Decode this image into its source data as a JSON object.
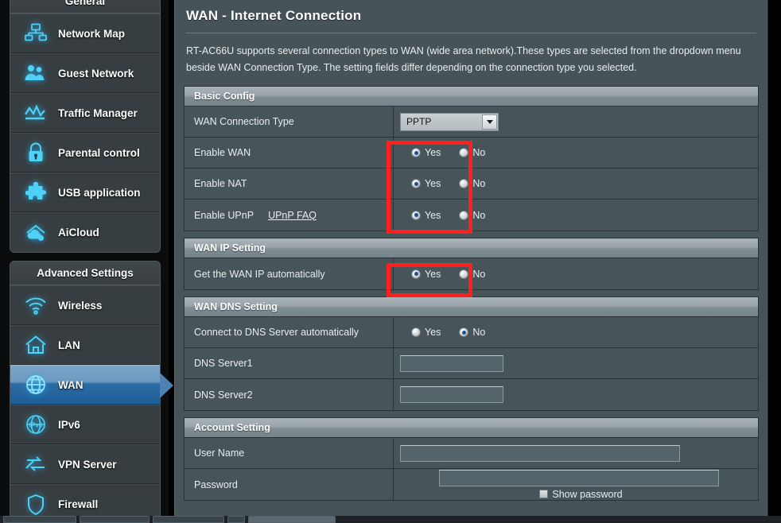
{
  "sidebar": {
    "general": {
      "title": "General",
      "items": [
        {
          "label": "Network Map",
          "icon": "network-map-icon"
        },
        {
          "label": "Guest Network",
          "icon": "guest-network-icon"
        },
        {
          "label": "Traffic Manager",
          "icon": "traffic-manager-icon"
        },
        {
          "label": "Parental control",
          "icon": "parental-control-icon"
        },
        {
          "label": "USB application",
          "icon": "usb-application-icon"
        },
        {
          "label": "AiCloud",
          "icon": "aicloud-icon"
        }
      ]
    },
    "advanced": {
      "title": "Advanced Settings",
      "items": [
        {
          "label": "Wireless",
          "icon": "wireless-icon",
          "active": false
        },
        {
          "label": "LAN",
          "icon": "lan-icon",
          "active": false
        },
        {
          "label": "WAN",
          "icon": "wan-icon",
          "active": true
        },
        {
          "label": "IPv6",
          "icon": "ipv6-icon",
          "active": false
        },
        {
          "label": "VPN Server",
          "icon": "vpn-server-icon",
          "active": false
        },
        {
          "label": "Firewall",
          "icon": "firewall-icon",
          "active": false
        }
      ]
    }
  },
  "page": {
    "title": "WAN - Internet Connection",
    "description": "RT-AC66U supports several connection types to WAN (wide area network).These types are selected from the dropdown menu beside WAN Connection Type. The setting fields differ depending on the connection type you selected."
  },
  "basic_config": {
    "heading": "Basic Config",
    "wan_connection_type": {
      "label": "WAN Connection Type",
      "value": "PPTP"
    },
    "enable_wan": {
      "label": "Enable WAN",
      "yes": "Yes",
      "no": "No",
      "selected": "Yes"
    },
    "enable_nat": {
      "label": "Enable NAT",
      "yes": "Yes",
      "no": "No",
      "selected": "Yes"
    },
    "enable_upnp": {
      "label": "Enable UPnP",
      "link": "UPnP  FAQ",
      "yes": "Yes",
      "no": "No",
      "selected": "Yes"
    }
  },
  "wan_ip_setting": {
    "heading": "WAN IP Setting",
    "get_wan_ip_auto": {
      "label": "Get the WAN IP automatically",
      "yes": "Yes",
      "no": "No",
      "selected": "Yes"
    }
  },
  "wan_dns_setting": {
    "heading": "WAN DNS Setting",
    "connect_dns_auto": {
      "label": "Connect to DNS Server automatically",
      "yes": "Yes",
      "no": "No",
      "selected": "No"
    },
    "dns_server1": {
      "label": "DNS Server1",
      "value": ""
    },
    "dns_server2": {
      "label": "DNS Server2",
      "value": ""
    }
  },
  "account_setting": {
    "heading": "Account Setting",
    "user_name": {
      "label": "User Name",
      "value": ""
    },
    "password": {
      "label": "Password",
      "value": "",
      "show_password": "Show password",
      "show_password_checked": false
    }
  },
  "colors": {
    "highlight": "#ff1f1f",
    "accent_blue": "#28a8e0",
    "panel_bg": "#47555a",
    "section_head": "#9aa5ab",
    "active_item": "#2b6ca4"
  }
}
